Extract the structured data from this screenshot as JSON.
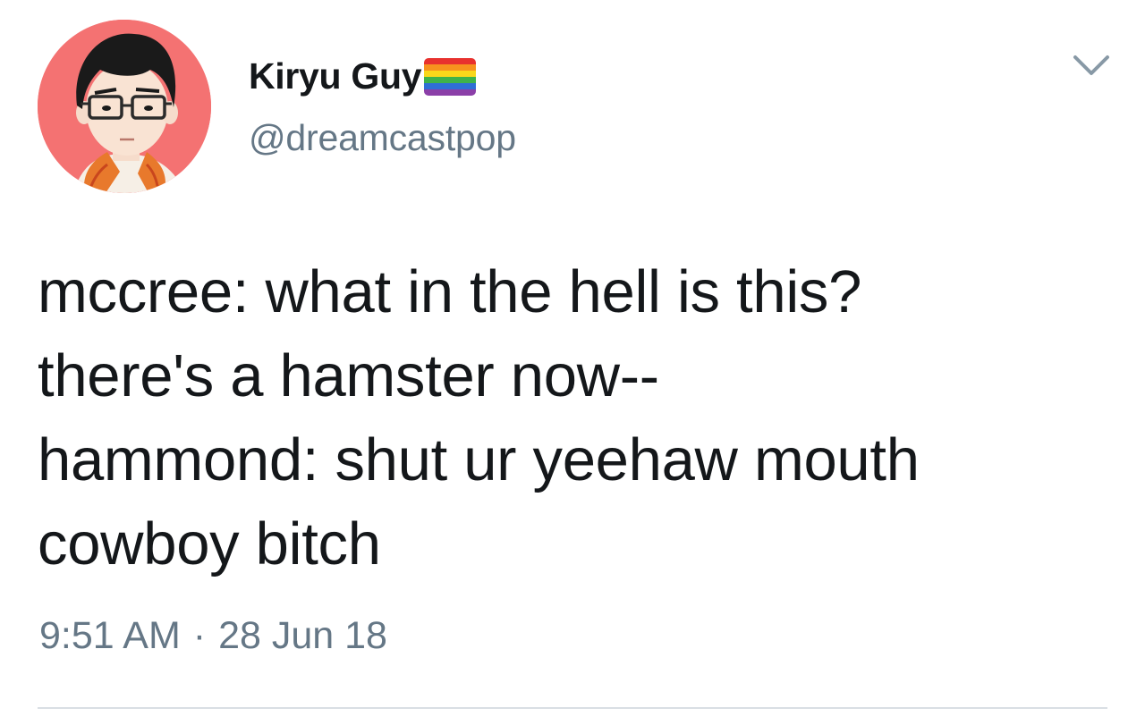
{
  "user": {
    "display_name": "Kiryu Guy",
    "handle": "@dreamcastpop",
    "name_badge": "rainbow-flag-emoji",
    "avatar": "illustrated-man-with-glasses-avatar"
  },
  "tweet": {
    "lines": [
      "mccree: what in the hell is this?",
      "there's a hamster now--",
      "hammond: shut ur yeehaw mouth",
      "cowboy bitch"
    ],
    "time": "9:51 AM",
    "separator": "·",
    "date": "28 Jun 18"
  },
  "icons": {
    "more": "chevron-down-icon"
  },
  "colors": {
    "text_primary": "#14171a",
    "text_secondary": "#657786",
    "avatar_bg": "#f47272",
    "divider": "#d9dfe4",
    "flag_stripes": [
      "#e8312e",
      "#f7921e",
      "#f9d81b",
      "#3fb34a",
      "#2f6fd6",
      "#8b3fa8"
    ]
  }
}
